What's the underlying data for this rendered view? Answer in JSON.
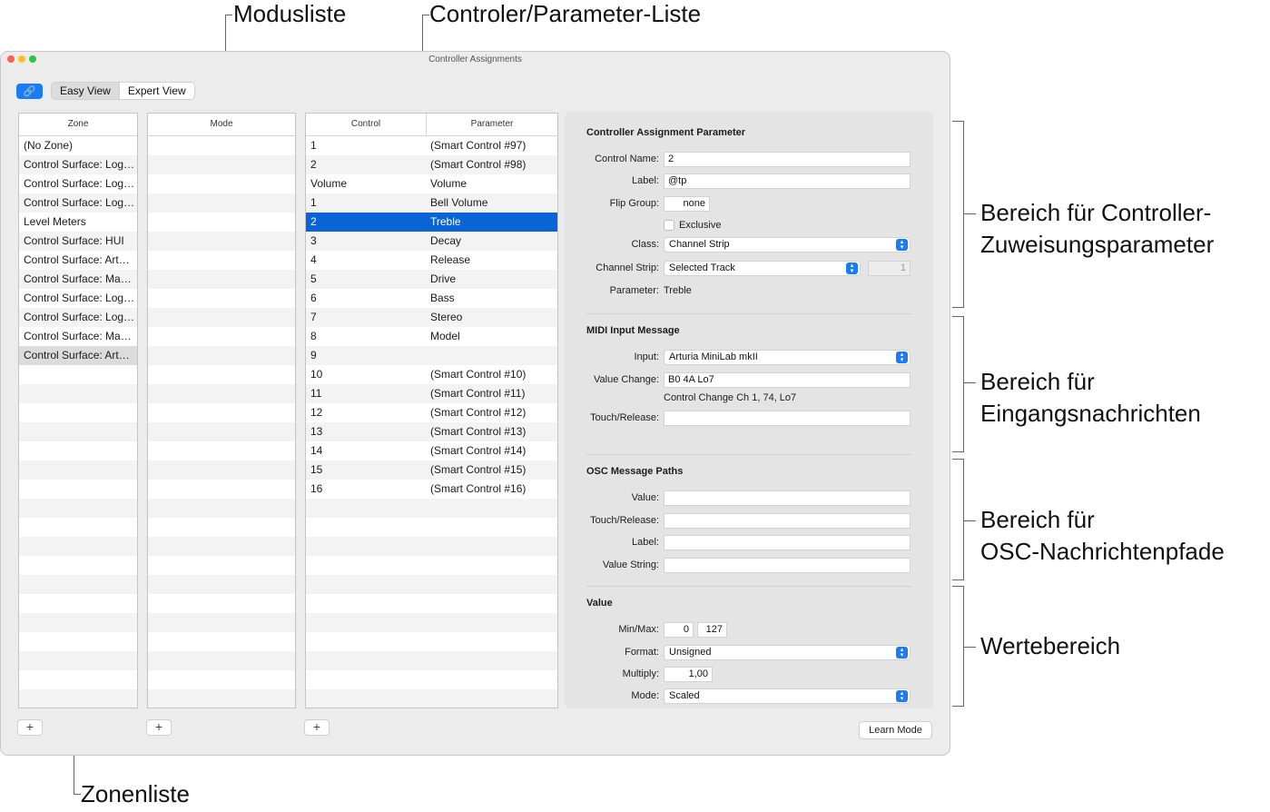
{
  "callouts": {
    "modusliste": "Modusliste",
    "controller_liste": "Controler/Parameter-Liste",
    "zuweisung_1": "Bereich für Controller-",
    "zuweisung_2": "Zuweisungsparameter",
    "eingang_1": "Bereich für",
    "eingang_2": "Eingangsnachrichten",
    "osc_1": "Bereich für",
    "osc_2": "OSC-Nachrichtenpfade",
    "werte": "Wertebereich",
    "zonenliste": "Zonenliste"
  },
  "window": {
    "title": "Controller Assignments",
    "traffic_colors": [
      "#ff5f57",
      "#febc2e",
      "#28c840"
    ]
  },
  "toolbar": {
    "easy_view": "Easy View",
    "expert_view": "Expert View",
    "link_icon": "link-icon"
  },
  "zone": {
    "header": "Zone",
    "items": [
      "(No Zone)",
      "Control Surface: Log…",
      "Control Surface: Log…",
      "Control Surface: Log…",
      "Level Meters",
      "Control Surface: HUI",
      "Control Surface: Art…",
      "Control Surface: Ma…",
      "Control Surface: Log…",
      "Control Surface: Log…",
      "Control Surface: Ma…",
      "Control Surface: Art…"
    ]
  },
  "mode": {
    "header": "Mode"
  },
  "controls": {
    "header_control": "Control",
    "header_parameter": "Parameter",
    "rows": [
      {
        "control": "1",
        "parameter": "(Smart Control #97)"
      },
      {
        "control": "2",
        "parameter": "(Smart Control #98)"
      },
      {
        "control": "Volume",
        "parameter": "Volume"
      },
      {
        "control": "1",
        "parameter": "Bell Volume"
      },
      {
        "control": "2",
        "parameter": "Treble"
      },
      {
        "control": "3",
        "parameter": "Decay"
      },
      {
        "control": "4",
        "parameter": "Release"
      },
      {
        "control": "5",
        "parameter": "Drive"
      },
      {
        "control": "6",
        "parameter": "Bass"
      },
      {
        "control": "7",
        "parameter": "Stereo"
      },
      {
        "control": "8",
        "parameter": "Model"
      },
      {
        "control": "9",
        "parameter": ""
      },
      {
        "control": "10",
        "parameter": "(Smart Control #10)"
      },
      {
        "control": "11",
        "parameter": "(Smart Control #11)"
      },
      {
        "control": "12",
        "parameter": "(Smart Control #12)"
      },
      {
        "control": "13",
        "parameter": "(Smart Control #13)"
      },
      {
        "control": "14",
        "parameter": "(Smart Control #14)"
      },
      {
        "control": "15",
        "parameter": "(Smart Control #15)"
      },
      {
        "control": "16",
        "parameter": "(Smart Control #16)"
      }
    ]
  },
  "add_label": "+",
  "inspector": {
    "cap_title": "Controller Assignment Parameter",
    "control_name_label": "Control Name:",
    "control_name": "2",
    "label_label": "Label:",
    "label_value": "@tp",
    "flip_group_label": "Flip Group:",
    "flip_group": "none",
    "exclusive_label": "Exclusive",
    "class_label": "Class:",
    "class_value": "Channel Strip",
    "channel_strip_label": "Channel Strip:",
    "channel_strip_value": "Selected Track",
    "channel_strip_num": "1",
    "parameter_label": "Parameter:",
    "parameter_value": "Treble",
    "midi_title": "MIDI Input Message",
    "input_label": "Input:",
    "input_value": "Arturia MiniLab mkII",
    "value_change_label": "Value Change:",
    "value_change": "B0 4A Lo7",
    "cc_text": "Control Change Ch 1, 74, Lo7",
    "touch_label": "Touch/Release:",
    "osc_title": "OSC Message Paths",
    "osc_value_label": "Value:",
    "osc_touch_label": "Touch/Release:",
    "osc_label_label": "Label:",
    "osc_string_label": "Value String:",
    "value_title": "Value",
    "minmax_label": "Min/Max:",
    "min": "0",
    "max": "127",
    "format_label": "Format:",
    "format_value": "Unsigned",
    "multiply_label": "Multiply:",
    "multiply_value": "1,00",
    "mode_label": "Mode:",
    "mode_value": "Scaled"
  },
  "learn_mode": "Learn Mode"
}
